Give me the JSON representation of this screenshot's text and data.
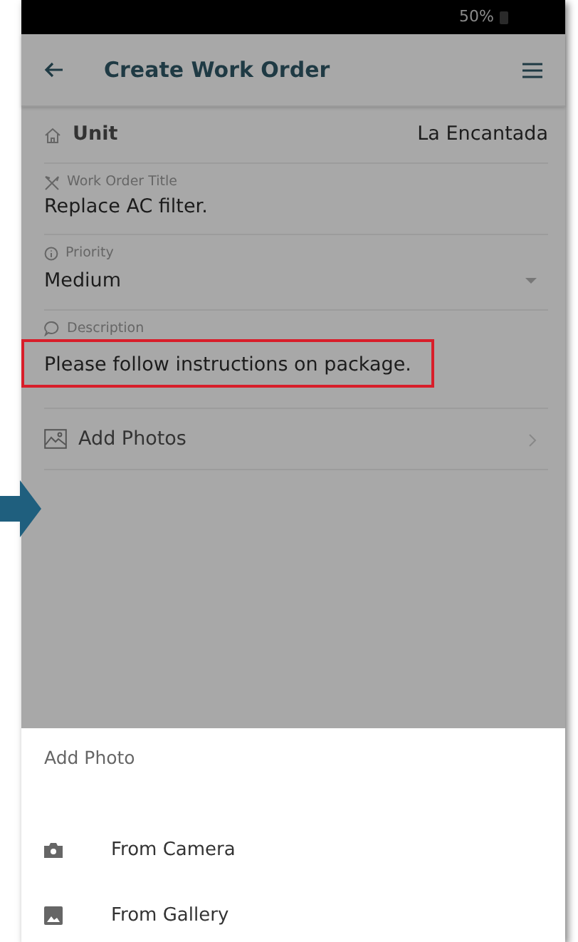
{
  "status_bar": {
    "battery": "50%"
  },
  "header": {
    "title": "Create Work Order"
  },
  "fields": [
    {
      "kind": "inline",
      "label": "Unit",
      "value": "La Encantada",
      "highlighted": false
    },
    {
      "kind": "text",
      "label": "Work Order Title",
      "value": "Replace AC filter.",
      "highlighted": false
    },
    {
      "kind": "select",
      "label": "Priority",
      "value": "Medium",
      "highlighted": false
    },
    {
      "kind": "text",
      "label": "Description",
      "value": "Please follow instructions on package.",
      "highlighted": true
    },
    {
      "kind": "link",
      "label": "Add Photos",
      "highlighted": false
    }
  ],
  "pointer_arrow": true,
  "sheet": {
    "title": "Add Photo",
    "options": [
      {
        "kind": "camera",
        "label": "From Camera"
      },
      {
        "kind": "gallery",
        "label": "From Gallery"
      }
    ]
  }
}
